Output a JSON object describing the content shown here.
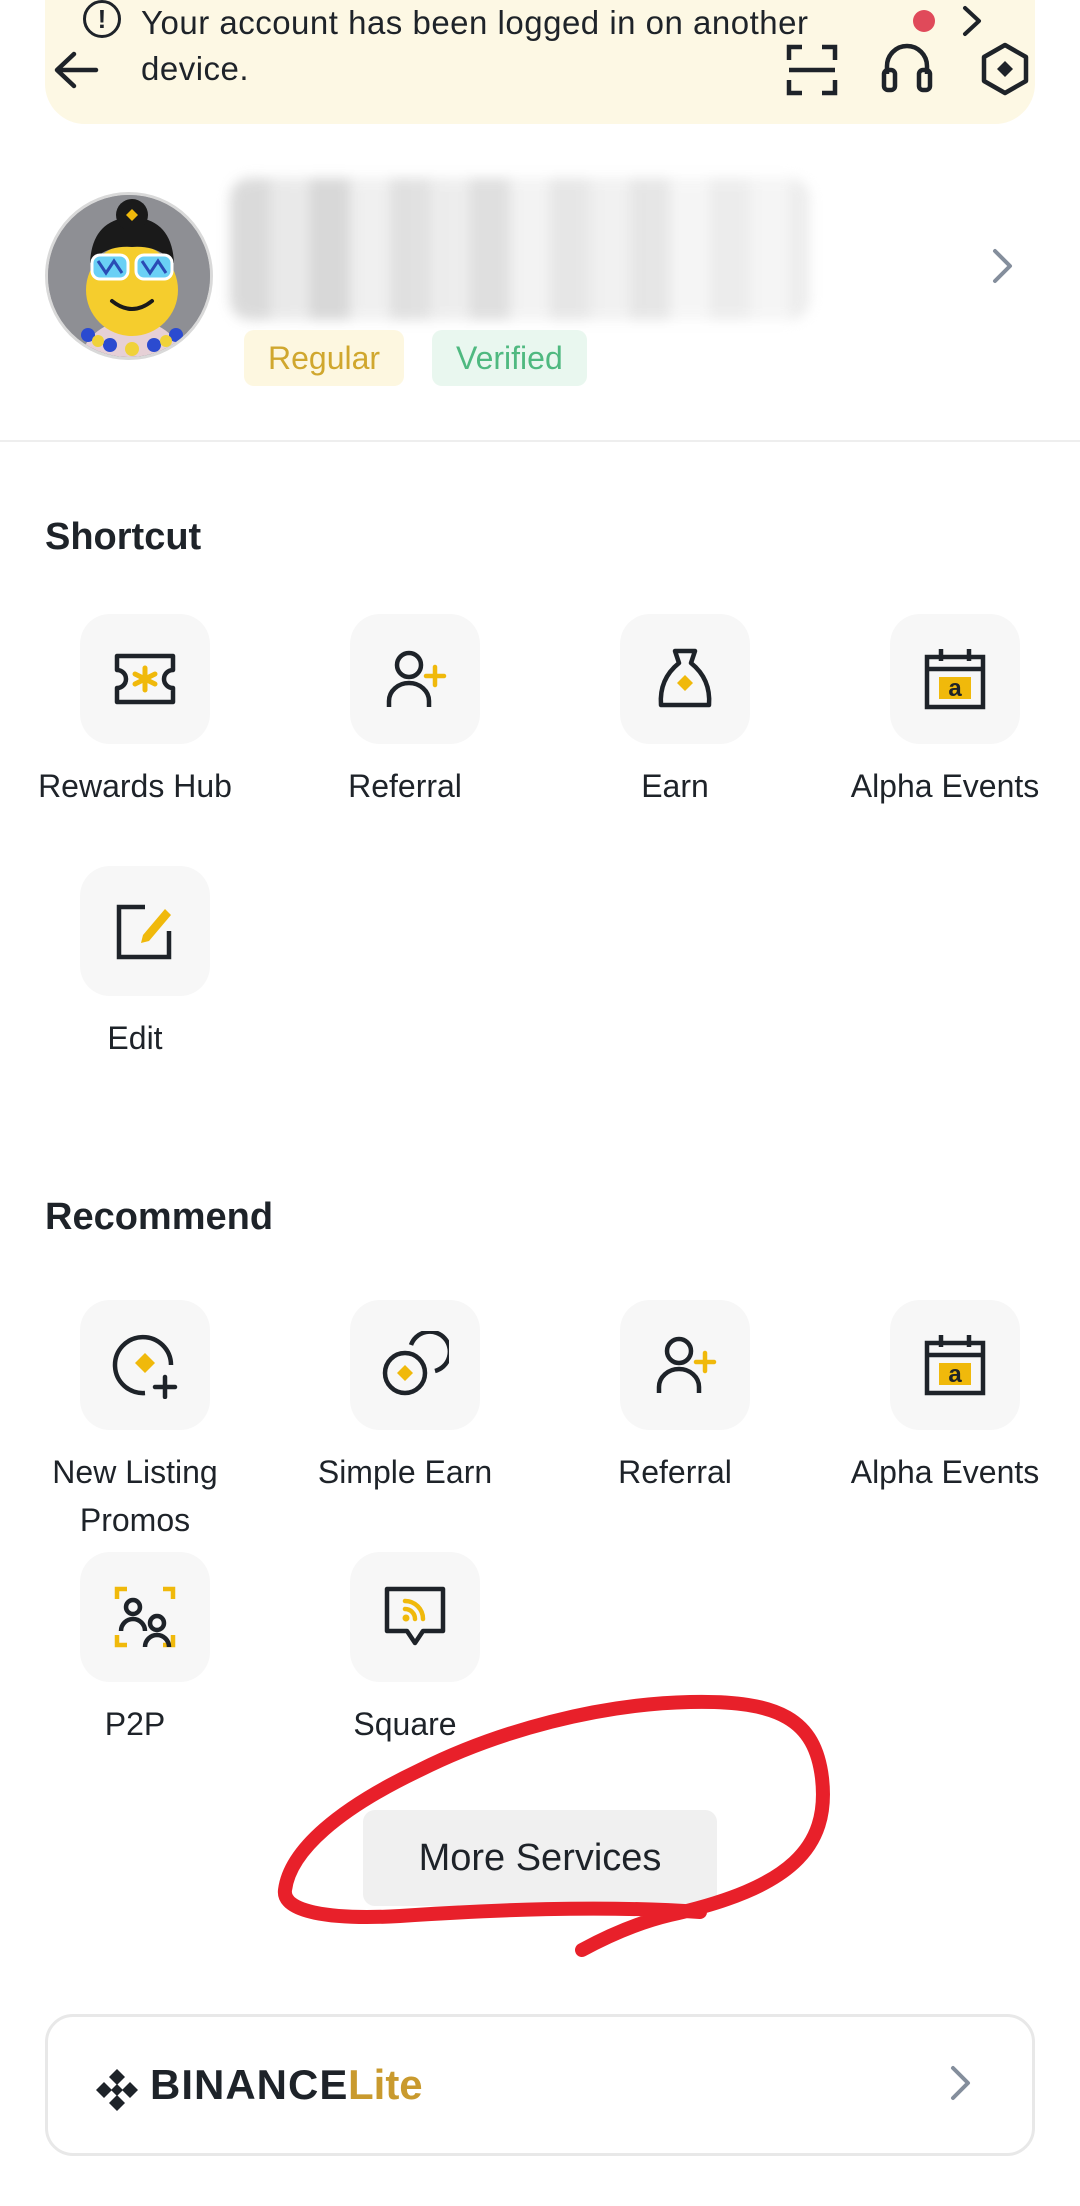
{
  "notice": {
    "message": "Your account has been logged in on another device."
  },
  "profile": {
    "badges": {
      "regular": "Regular",
      "verified": "Verified"
    }
  },
  "shortcut": {
    "title": "Shortcut",
    "items": [
      {
        "label": "Rewards Hub",
        "icon": "ticket-icon"
      },
      {
        "label": "Referral",
        "icon": "add-person-icon"
      },
      {
        "label": "Earn",
        "icon": "money-bag-icon"
      },
      {
        "label": "Alpha Events",
        "icon": "calendar-alpha-icon"
      },
      {
        "label": "Edit",
        "icon": "edit-icon"
      }
    ]
  },
  "recommend": {
    "title": "Recommend",
    "items": [
      {
        "label": "New Listing Promos",
        "icon": "new-listing-icon"
      },
      {
        "label": "Simple Earn",
        "icon": "coins-icon"
      },
      {
        "label": "Referral",
        "icon": "add-person-icon"
      },
      {
        "label": "Alpha Events",
        "icon": "calendar-alpha-icon"
      },
      {
        "label": "P2P",
        "icon": "p2p-icon"
      },
      {
        "label": "Square",
        "icon": "square-feed-icon"
      }
    ]
  },
  "more_services": {
    "label": "More Services"
  },
  "lite": {
    "brand": "BINANCE",
    "mode": "Lite"
  },
  "colors": {
    "accent": "#F0B90B",
    "text": "#1E2329",
    "annotation": "#E8202A"
  }
}
